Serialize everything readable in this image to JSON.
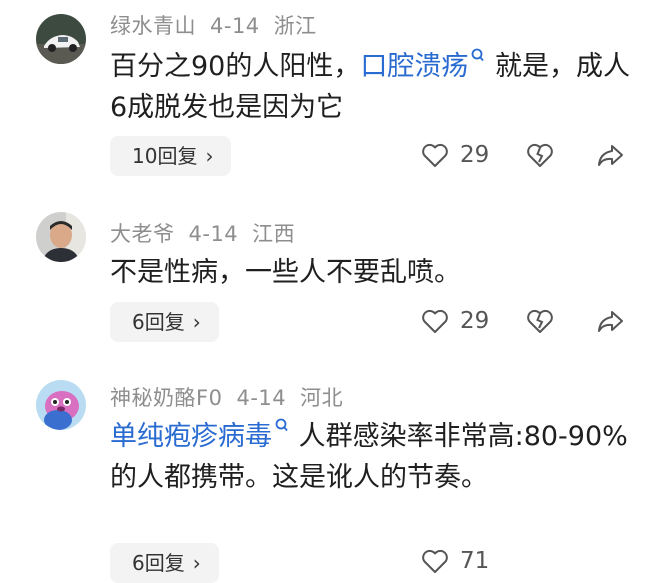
{
  "comments": [
    {
      "username": "绿水青山",
      "date": "4-14",
      "location": "浙江",
      "text_before": "百分之90的人阳性，",
      "topic": "口腔溃疡",
      "text_after": "就是，成人6成脱发也是因为它",
      "replies": "10回复",
      "likes": "29"
    },
    {
      "username": "大老爷",
      "date": "4-14",
      "location": "江西",
      "text_before": "不是性病，一些人不要乱喷。",
      "topic": "",
      "text_after": "",
      "replies": "6回复",
      "likes": "29"
    },
    {
      "username": "神秘奶酪F0",
      "date": "4-14",
      "location": "河北",
      "text_before": "",
      "topic": "单纯疱疹病毒",
      "text_after": "人群感染率非常高:80-90%的人都携带。这是讹人的节奏。",
      "replies": "6回复",
      "likes": "71"
    }
  ],
  "icons": {
    "like": "heart-outline-icon",
    "dislike": "broken-heart-icon",
    "share": "share-arrow-icon",
    "topic_search": "search-icon"
  },
  "colors": {
    "topic_link": "#2a6bd1",
    "meta_text": "#8e8e8e",
    "reply_button_bg": "#f3f3f3"
  }
}
